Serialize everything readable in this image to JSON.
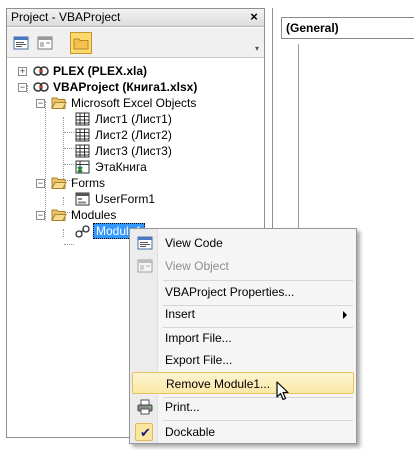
{
  "project_window": {
    "title": "Project - VBAProject",
    "close_glyph": "×",
    "toolbar": {
      "buttons": [
        {
          "name": "view-code",
          "icon": "view-code-icon",
          "active": false
        },
        {
          "name": "view-object",
          "icon": "view-object-icon",
          "active": false
        },
        {
          "name": "toggle-folders",
          "icon": "folder-icon",
          "active": true
        }
      ]
    },
    "tree": {
      "plex": "PLEX (PLEX.xla)",
      "vbaproject": "VBAProject (Книга1.xlsx)",
      "excel_objects": "Microsoft Excel Objects",
      "sheet1": "Лист1 (Лист1)",
      "sheet2": "Лист2 (Лист2)",
      "sheet3": "Лист3 (Лист3)",
      "thisworkbook": "ЭтаКнига",
      "forms": "Forms",
      "userform1": "UserForm1",
      "modules": "Modules",
      "module1": "Module1",
      "expander_plus": "+",
      "expander_minus": "−"
    }
  },
  "code_window": {
    "object_combo": "(General)"
  },
  "context_menu": {
    "items": [
      {
        "label": "View Code",
        "icon": "view-code-icon",
        "disabled": false
      },
      {
        "label": "View Object",
        "icon": "view-object-icon",
        "disabled": true
      },
      {
        "label": "VBAProject Properties...",
        "disabled": false
      },
      {
        "label": "Insert",
        "submenu": true,
        "disabled": false
      },
      {
        "label": "Import File...",
        "disabled": false
      },
      {
        "label": "Export File...",
        "disabled": false
      },
      {
        "label": "Remove Module1...",
        "disabled": false,
        "hover": true
      },
      {
        "label": "Print...",
        "icon": "printer-icon",
        "disabled": false
      },
      {
        "label": "Dockable",
        "checked": true,
        "check_glyph": "✔",
        "disabled": false
      }
    ]
  },
  "colors": {
    "selection": "#3399ff",
    "menu_hover": "#fbe9a6",
    "toolbar_active": "#fbd96c"
  }
}
